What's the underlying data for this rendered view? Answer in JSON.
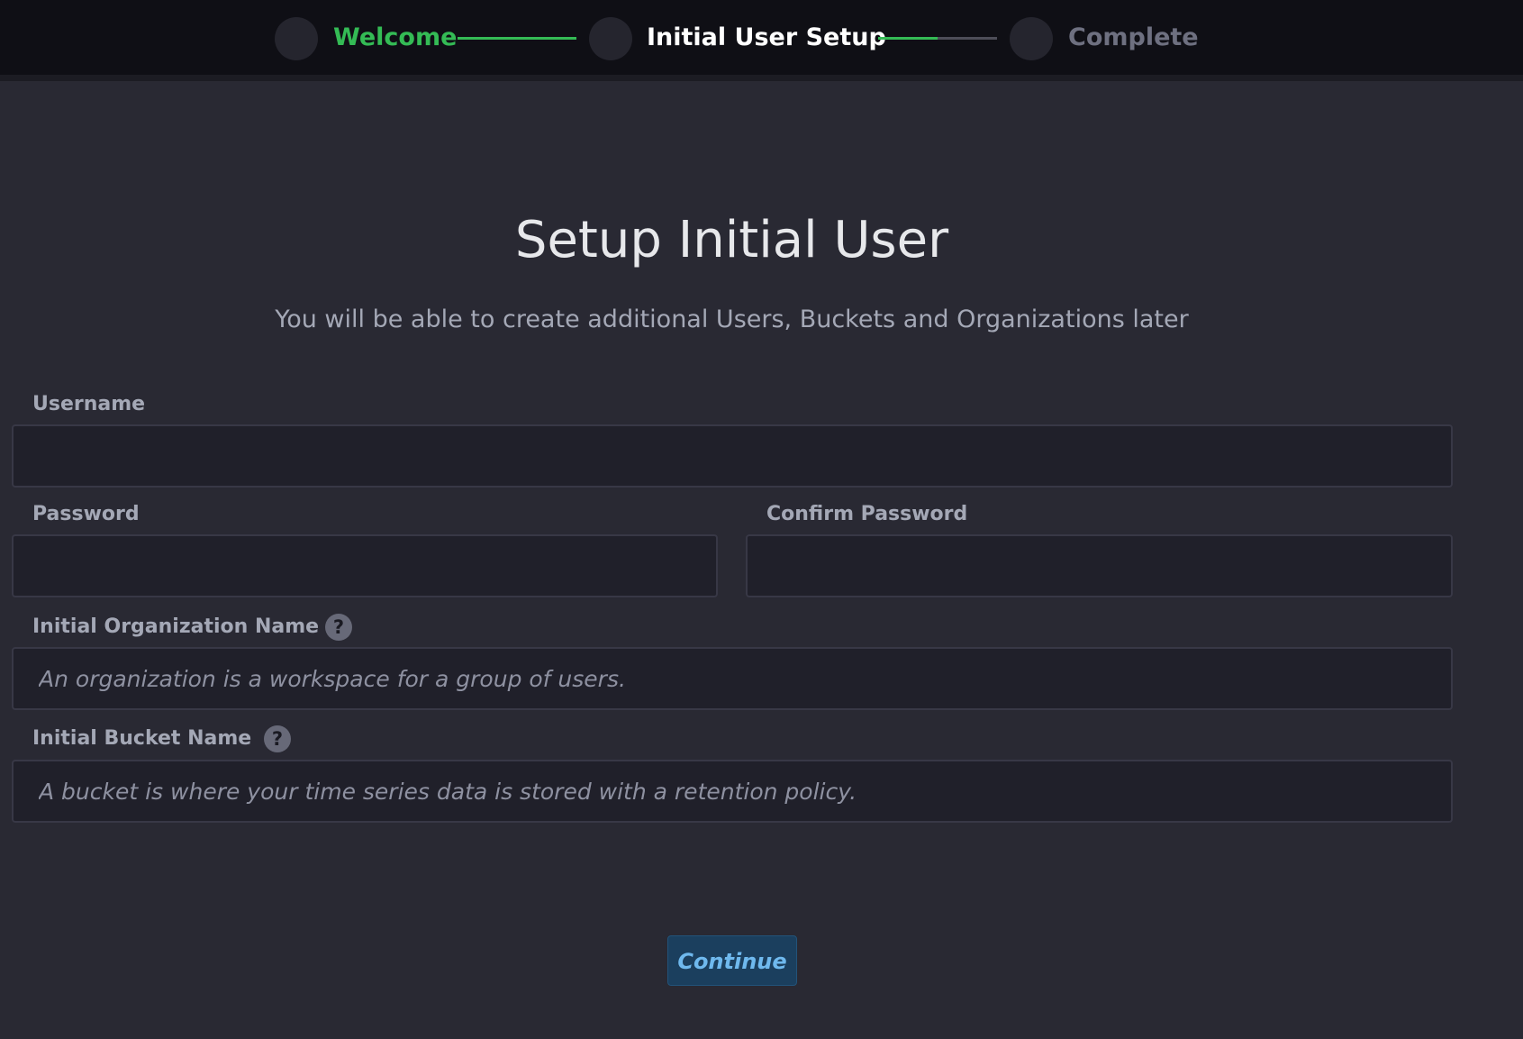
{
  "stepper": {
    "steps": [
      {
        "label": "Welcome",
        "state": "done",
        "color": "#34bb55"
      },
      {
        "label": "Initial User Setup",
        "state": "current",
        "color": "#ffffff"
      },
      {
        "label": "Complete",
        "state": "pending",
        "color": "#6e7080"
      }
    ],
    "connectors": [
      {
        "progress": 1.0
      },
      {
        "progress": 0.5
      }
    ],
    "accent_color": "#34bb55"
  },
  "page": {
    "title": "Setup Initial User",
    "subtitle": "You will be able to create additional Users, Buckets and Organizations later"
  },
  "form": {
    "username": {
      "label": "Username",
      "value": "",
      "placeholder": ""
    },
    "password": {
      "label": "Password",
      "value": "",
      "placeholder": ""
    },
    "confirm_password": {
      "label": "Confirm Password",
      "value": "",
      "placeholder": ""
    },
    "org_name": {
      "label": "Initial Organization Name",
      "value": "",
      "placeholder": "An organization is a workspace for a group of users.",
      "help_icon": "question-icon"
    },
    "bucket_name": {
      "label": "Initial Bucket Name",
      "value": "",
      "placeholder": "A bucket is where your time series data is stored with a retention policy.",
      "help_icon": "question-icon"
    }
  },
  "actions": {
    "continue_label": "Continue",
    "continue_color": "#6fb9ee"
  }
}
